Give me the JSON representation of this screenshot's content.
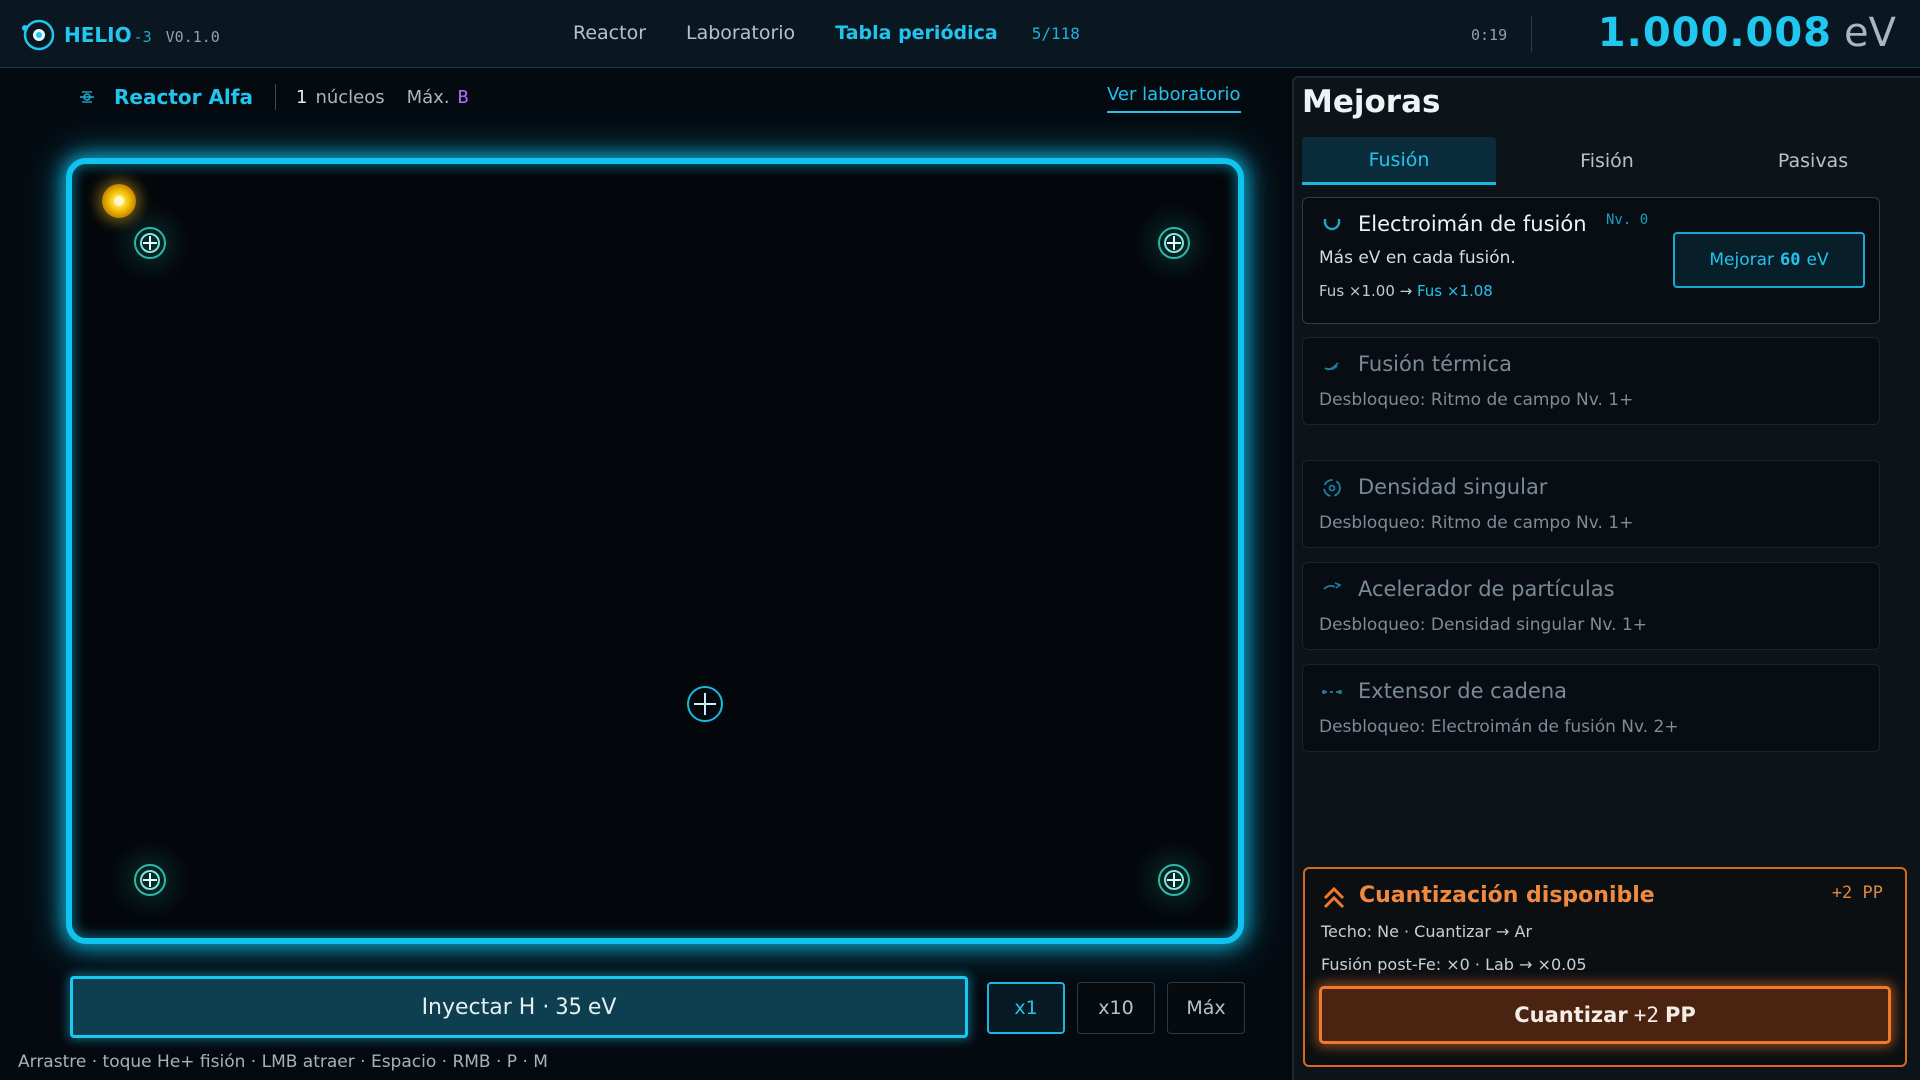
{
  "app": {
    "name": "HELIO",
    "sub": "-3",
    "version": "V0.1.0"
  },
  "nav": {
    "items": [
      "Reactor",
      "Laboratorio",
      "Tabla periódica"
    ],
    "active": "Tabla periódica",
    "element_count": "5/118"
  },
  "timer": "0:19",
  "balance": {
    "value": "1.000.008",
    "unit": "eV"
  },
  "reactor": {
    "name": "Reactor Alfa",
    "nuclei_count": "1",
    "nuclei_label": "núcleos",
    "max_label": "Máx.",
    "max_value": "B",
    "view_lab": "Ver laboratorio"
  },
  "controls": {
    "inject_label": "Inyectar H ·",
    "inject_cost": "35",
    "inject_unit": "eV",
    "multipliers": [
      "x1",
      "x10",
      "Máx"
    ],
    "active_multiplier": "x1",
    "hint": "Arrastre · toque He+ fisión · LMB atraer · Espacio · RMB · P · M"
  },
  "upgrades": {
    "title": "Mejoras",
    "tabs": [
      "Fusión",
      "Fisión",
      "Pasivas"
    ],
    "active_tab": "Fusión",
    "cards": [
      {
        "title": "Electroimán de fusión",
        "level": "Nv. 0",
        "desc": "Más eV en cada fusión.",
        "fx_from": "Fus ×1.00 →",
        "fx_to": "Fus ×1.08",
        "button_label": "Mejorar",
        "button_cost": "60",
        "button_unit": "eV",
        "icon": "magnet-icon"
      },
      {
        "title": "Fusión térmica",
        "unlock": "Desbloqueo: Ritmo de campo Nv. 1+",
        "icon": "flame-icon"
      },
      {
        "title": "Densidad singular",
        "unlock": "Desbloqueo: Ritmo de campo Nv. 1+",
        "icon": "singularity-icon"
      },
      {
        "title": "Acelerador de partículas",
        "unlock": "Desbloqueo: Densidad singular Nv. 1+",
        "icon": "accelerator-icon"
      },
      {
        "title": "Extensor de cadena",
        "unlock": "Desbloqueo: Electroimán de fusión Nv. 2+",
        "icon": "chain-icon"
      }
    ]
  },
  "quantize": {
    "title": "Cuantización disponible",
    "pp": "+2 PP",
    "line1": "Techo: Ne · Cuantizar → Ar",
    "line2": "Fusión post-Fe: ×0 · Lab → ×0.05",
    "button_label": "Cuantizar",
    "button_amount": "+2",
    "button_unit": "PP"
  },
  "colors": {
    "accent": "#22c4ee",
    "reactor_border": "#10c4f0",
    "particle": "#f0b800",
    "quantize": "#f07a2a",
    "max_element": "#b070ff"
  }
}
